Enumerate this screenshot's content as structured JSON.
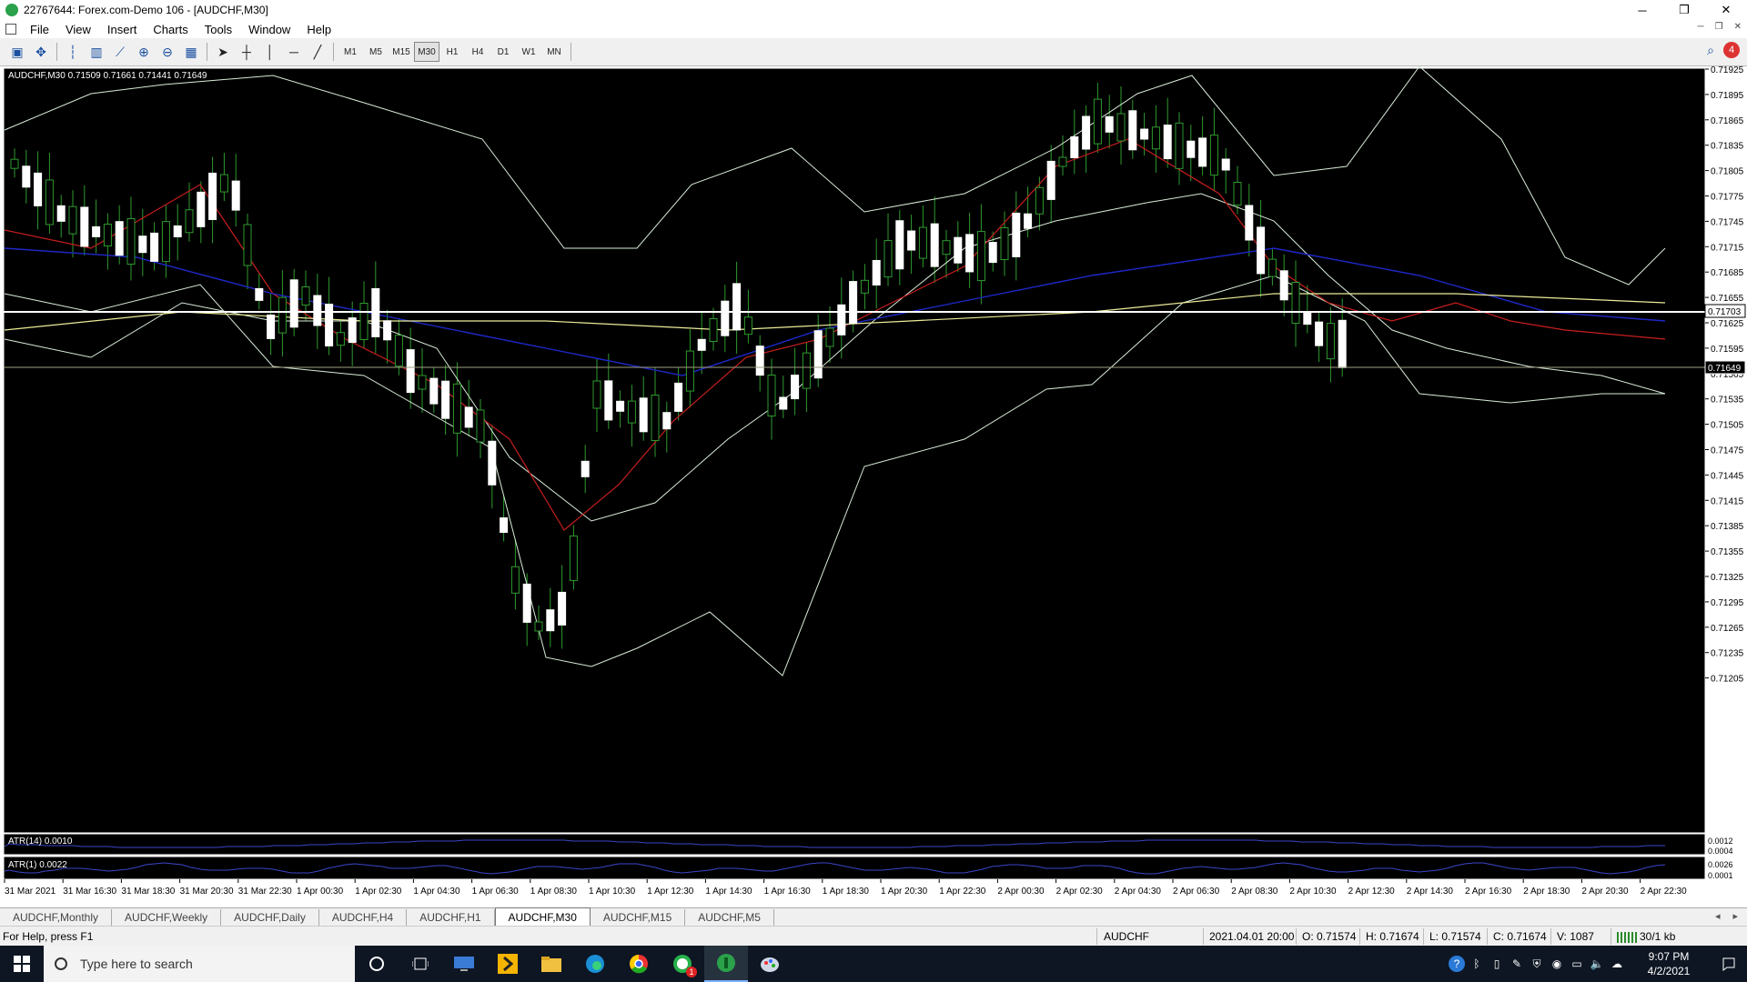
{
  "window": {
    "title": "22767644: Forex.com-Demo 106 - [AUDCHF,M30]",
    "minimize": "─",
    "restore": "❐",
    "close": "✕"
  },
  "menu": [
    "File",
    "View",
    "Insert",
    "Charts",
    "Tools",
    "Window",
    "Help"
  ],
  "toolbar": {
    "timeframes": [
      "M1",
      "M5",
      "M15",
      "M30",
      "H1",
      "H4",
      "D1",
      "W1",
      "MN"
    ],
    "active_timeframe": "M30",
    "alert_count": "4"
  },
  "chart": {
    "header": "AUDCHF,M30  0.71509 0.71661 0.71441 0.71649",
    "price_labels": [
      "0.71925",
      "0.71895",
      "0.71865",
      "0.71835",
      "0.71805",
      "0.71775",
      "0.71745",
      "0.71715",
      "0.71685",
      "0.71655",
      "0.71625",
      "0.71595",
      "0.71565",
      "0.71535",
      "0.71505",
      "0.71475",
      "0.71445",
      "0.71415",
      "0.71385",
      "0.71355",
      "0.71325",
      "0.71295",
      "0.71265",
      "0.71235",
      "0.71205"
    ],
    "hline_label": "0.71703",
    "bid_label": "0.71649",
    "time_labels": [
      "31 Mar 2021",
      "31 Mar 16:30",
      "31 Mar 18:30",
      "31 Mar 20:30",
      "31 Mar 22:30",
      "1 Apr 00:30",
      "1 Apr 02:30",
      "1 Apr 04:30",
      "1 Apr 06:30",
      "1 Apr 08:30",
      "1 Apr 10:30",
      "1 Apr 12:30",
      "1 Apr 14:30",
      "1 Apr 16:30",
      "1 Apr 18:30",
      "1 Apr 20:30",
      "1 Apr 22:30",
      "2 Apr 00:30",
      "2 Apr 02:30",
      "2 Apr 04:30",
      "2 Apr 06:30",
      "2 Apr 08:30",
      "2 Apr 10:30",
      "2 Apr 12:30",
      "2 Apr 14:30",
      "2 Apr 16:30",
      "2 Apr 18:30",
      "2 Apr 20:30",
      "2 Apr 22:30"
    ],
    "atr14": {
      "label": "ATR(14) 0.0010",
      "scale": [
        "0.0012",
        "0.0004"
      ]
    },
    "atr1": {
      "label": "ATR(1) 0.0022",
      "scale": [
        "0.0026",
        "0.0001"
      ]
    },
    "colors": {
      "bull": "#ffffff",
      "bear": "#ffffff",
      "wick": "#2e9a2e",
      "bands": "#d8ecd8",
      "ma_fast": "#c81e1e",
      "ma_mid": "#d8ecd8",
      "ma_blue": "#1e28c8",
      "ma_slow": "#ecec9a",
      "atr": "#3a46c8"
    }
  },
  "tabs": [
    "AUDCHF,Monthly",
    "AUDCHF,Weekly",
    "AUDCHF,Daily",
    "AUDCHF,H4",
    "AUDCHF,H1",
    "AUDCHF,M30",
    "AUDCHF,M15",
    "AUDCHF,M5"
  ],
  "active_tab": "AUDCHF,M30",
  "status": {
    "help": "For Help, press F1",
    "symbol": "AUDCHF",
    "datetime": "2021.04.01 20:00",
    "open": "O: 0.71574",
    "high": "H: 0.71674",
    "low": "L: 0.71574",
    "close": "C: 0.71674",
    "volume": "V: 1087",
    "traffic": "30/1 kb"
  },
  "taskbar": {
    "search_placeholder": "Type here to search",
    "time": "9:07 PM",
    "date": "4/2/2021",
    "chat_badge": "1"
  }
}
